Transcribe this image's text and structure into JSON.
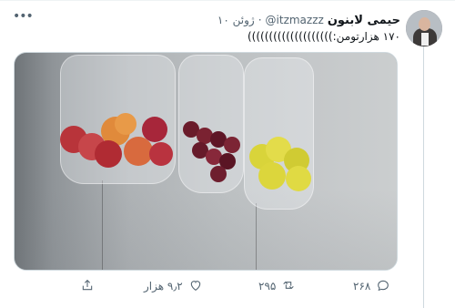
{
  "tweet": {
    "name": "حیمی لابنون",
    "handle": "@itzmazzz",
    "dot": "·",
    "time": "۱۰ ژوئن",
    "text": "۱۷۰ هزارتومن:))))))))))))))))))))"
  },
  "actions": {
    "reply_count": "۲۶۸",
    "retweet_count": "۲۹۵",
    "like_count": "۹٫۲ هزار",
    "share_label": ""
  },
  "icons": {
    "more": "more-icon",
    "reply": "reply-icon",
    "retweet": "retweet-icon",
    "like": "heart-icon",
    "share": "share-icon"
  },
  "colors": {
    "text": "#0f1419",
    "muted": "#536471",
    "border": "#cfd9de"
  }
}
